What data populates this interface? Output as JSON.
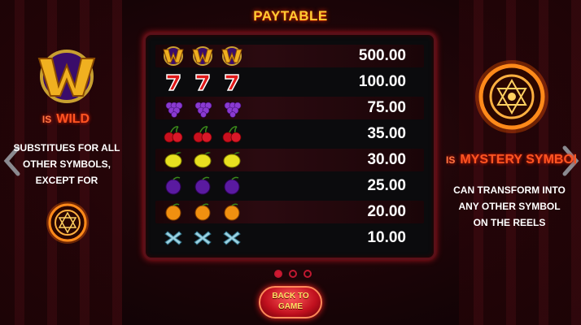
{
  "title": "PAYTABLE",
  "paytable": [
    {
      "symbol": "wild-w",
      "value": "500.00"
    },
    {
      "symbol": "seven",
      "value": "100.00"
    },
    {
      "symbol": "grapes",
      "value": "75.00"
    },
    {
      "symbol": "cherries",
      "value": "35.00"
    },
    {
      "symbol": "lemon",
      "value": "30.00"
    },
    {
      "symbol": "plum",
      "value": "25.00"
    },
    {
      "symbol": "orange",
      "value": "20.00"
    },
    {
      "symbol": "x",
      "value": "10.00"
    }
  ],
  "left": {
    "is": "IS",
    "name": "WILD",
    "lines": [
      "SUBSTITUES FOR ALL",
      "OTHER SYMBOLS,",
      "EXCEPT FOR"
    ]
  },
  "right": {
    "is": "IS",
    "name": "MYSTERY SYMBOL",
    "lines": [
      "CAN TRANSFORM INTO",
      "ANY OTHER SYMBOL",
      "ON THE REELS"
    ]
  },
  "back_button": {
    "line1": "BACK TO",
    "line2": "GAME"
  },
  "pages": {
    "count": 3,
    "current": 1
  },
  "colors": {
    "accent": "#ff5522",
    "gold": "#ffcc33",
    "frame": "#b0141e"
  }
}
